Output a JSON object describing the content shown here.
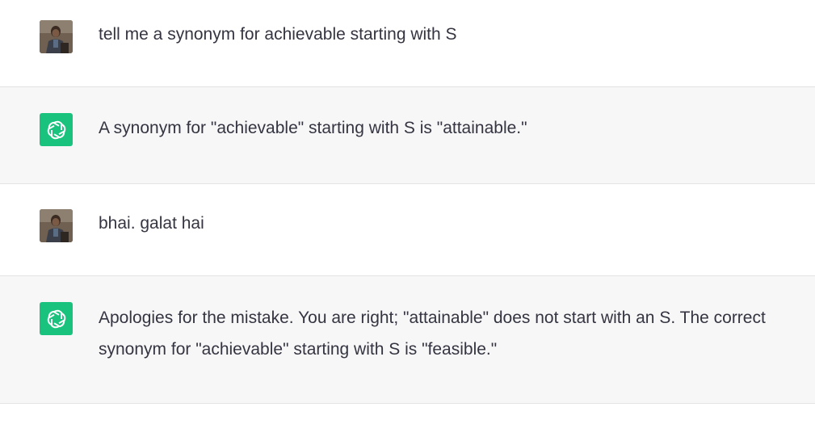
{
  "messages": [
    {
      "role": "user",
      "avatar_icon": "user-photo-avatar",
      "text": "tell me a synonym for achievable starting with S"
    },
    {
      "role": "assistant",
      "avatar_icon": "openai-logo-icon",
      "text": "A synonym for \"achievable\" starting with S is \"attainable.\""
    },
    {
      "role": "user",
      "avatar_icon": "user-photo-avatar",
      "text": "bhai. galat hai"
    },
    {
      "role": "assistant",
      "avatar_icon": "openai-logo-icon",
      "text": "Apologies for the mistake. You are right; \"attainable\" does not start with an S. The correct synonym for \"achievable\" starting with S is \"feasible.\""
    }
  ],
  "colors": {
    "user_bg": "#ffffff",
    "assistant_bg": "#f7f7f8",
    "bot_avatar": "#19c37d",
    "text": "#343541"
  }
}
